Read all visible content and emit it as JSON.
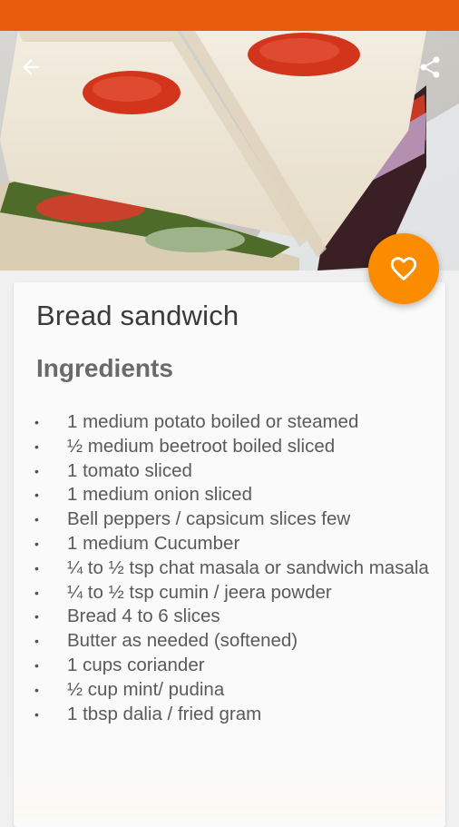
{
  "colors": {
    "status_bar": "#e85c0d",
    "fab": "#fb8c00",
    "card": "#fafafa",
    "title_text": "#3a3a3a",
    "section_text": "#6a6a6a",
    "ingredient_text": "#5a5a5a"
  },
  "appbar": {
    "back_icon": "arrow-back-icon",
    "share_icon": "share-icon"
  },
  "hero": {
    "image": "bread-sandwich-photo"
  },
  "fab": {
    "icon": "heart-outline-icon"
  },
  "recipe": {
    "title": "Bread sandwich",
    "section_title": "Ingredients",
    "bullet": "•",
    "ingredients": [
      "1 medium potato boiled or steamed",
      "½ medium beetroot boiled sliced",
      "1 tomato sliced",
      "1 medium onion sliced",
      "Bell peppers / capsicum slices few",
      "1 medium Cucumber",
      "¼ to ½ tsp chat masala or sandwich masala",
      "¼ to ½ tsp cumin / jeera powder",
      "Bread 4 to 6 slices",
      "Butter as needed (softened)",
      "1 cups coriander",
      "½ cup mint/ pudina",
      "1 tbsp dalia / fried gram"
    ]
  }
}
